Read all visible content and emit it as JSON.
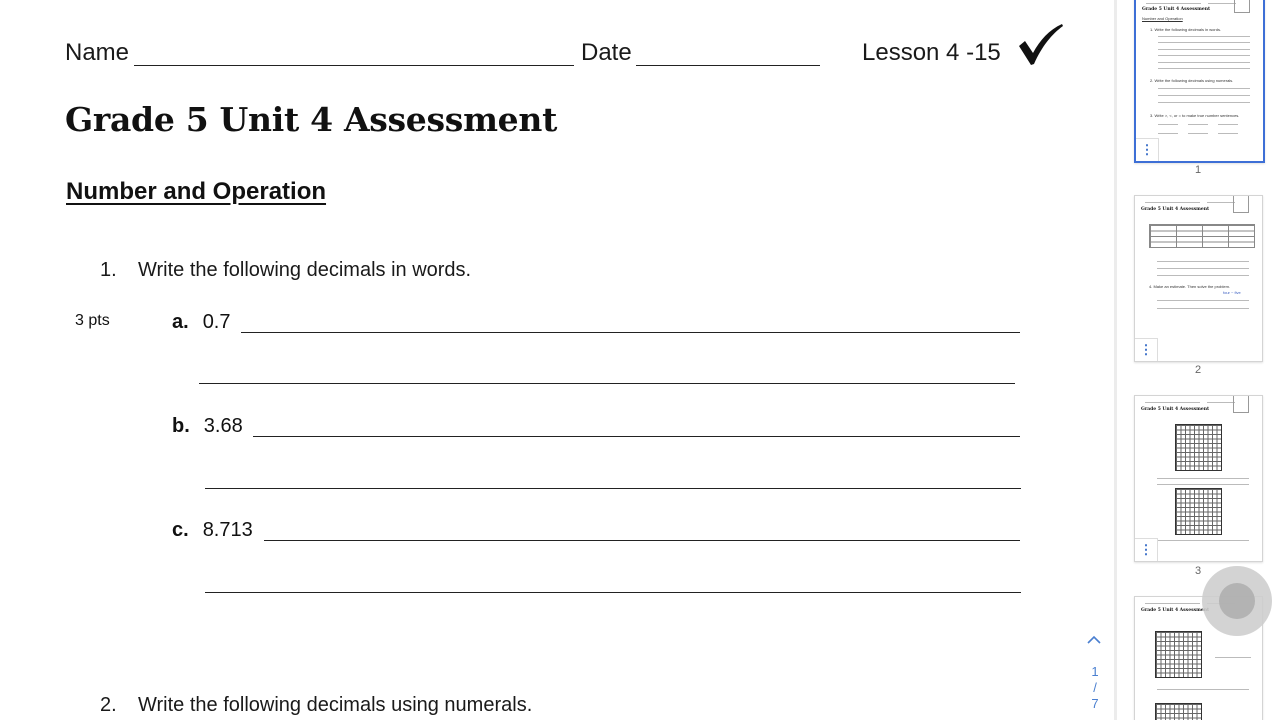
{
  "header": {
    "name_label": "Name",
    "date_label": "Date",
    "lesson_label": "Lesson 4 -15"
  },
  "title": "Grade 5 Unit 4 Assessment",
  "section": "Number and Operation",
  "question1": {
    "number": "1.",
    "prompt": "Write the following decimals in words.",
    "points": "3 pts",
    "items": [
      {
        "letter": "a.",
        "value": "0.7"
      },
      {
        "letter": "b.",
        "value": "3.68"
      },
      {
        "letter": "c.",
        "value": "8.713"
      }
    ]
  },
  "question2": {
    "number": "2.",
    "prompt": "Write the following decimals using numerals."
  },
  "thumbnails": {
    "pages": [
      "1",
      "2",
      "3"
    ],
    "menu_icon": "vertical-dots-icon"
  },
  "pager": {
    "current": "1",
    "separator": "/",
    "total": "7"
  },
  "colors": {
    "selection": "#3d6fd6",
    "accent": "#4a7fd0"
  }
}
